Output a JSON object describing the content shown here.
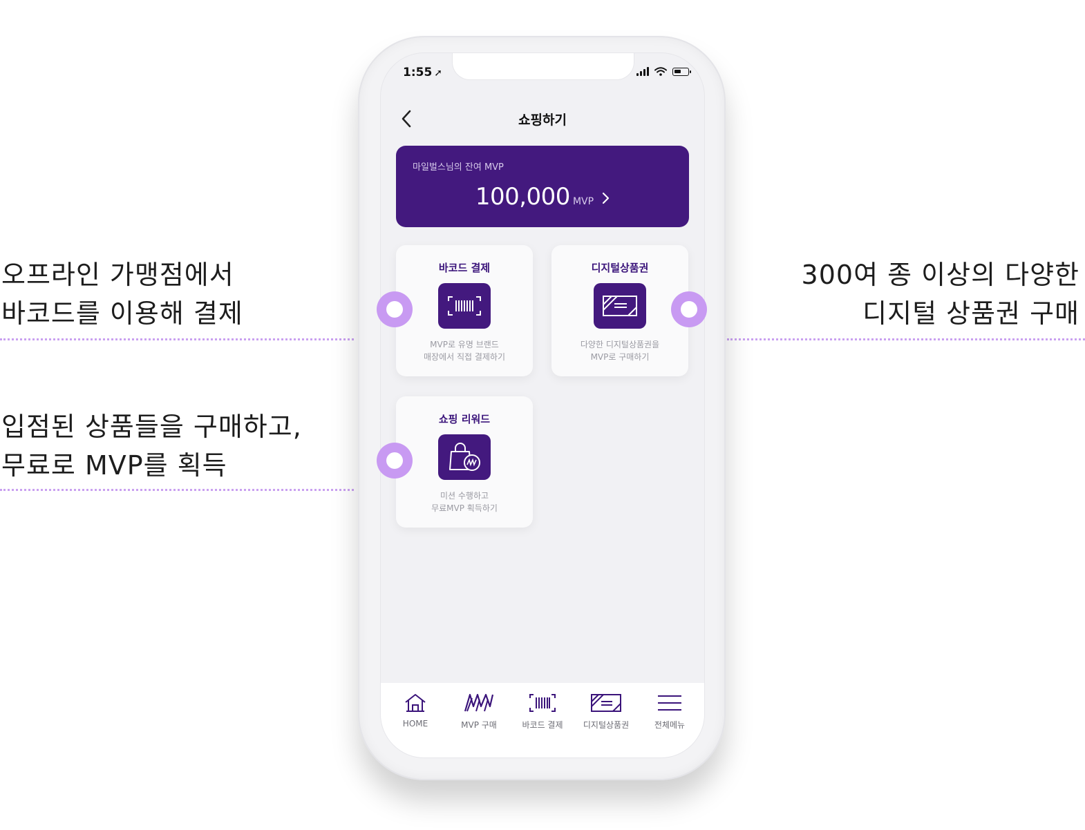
{
  "annotations": {
    "left_top": [
      "오프라인 가맹점에서",
      "바코드를 이용해 결제"
    ],
    "left_bottom": [
      "입점된 상품들을 구매하고,",
      "무료로 MVP를 획득"
    ],
    "right_top": [
      "300여 종 이상의 다양한",
      "디지털 상품권 구매"
    ]
  },
  "status_bar": {
    "time": "1:55",
    "arrow": "➚"
  },
  "nav": {
    "title": "쇼핑하기",
    "back_icon": "chevron-left-icon"
  },
  "balance": {
    "label": "마일벌스님의 잔여 MVP",
    "amount": "100,000",
    "unit": "MVP"
  },
  "cards": [
    {
      "title": "바코드 결제",
      "icon": "barcode-icon",
      "desc1": "MVP로 유명 브랜드",
      "desc2": "매장에서 직접 결제하기"
    },
    {
      "title": "디지털상품권",
      "icon": "gift-card-icon",
      "desc1": "다양한 디지털상품권을",
      "desc2": "MVP로 구매하기"
    },
    {
      "title": "쇼핑 리워드",
      "icon": "shopping-bag-icon",
      "desc1": "미션 수행하고",
      "desc2": "무료MVP 획득하기"
    }
  ],
  "tabs": [
    {
      "label": "HOME",
      "icon": "home-icon"
    },
    {
      "label": "MVP 구매",
      "icon": "mvp-logo-icon"
    },
    {
      "label": "바코드 결제",
      "icon": "barcode-icon"
    },
    {
      "label": "디지털상품권",
      "icon": "gift-card-icon"
    },
    {
      "label": "전체메뉴",
      "icon": "menu-icon"
    }
  ],
  "colors": {
    "brand_purple": "#43197e",
    "accent_pin": "#c89af2",
    "dotline": "#c9a0f0"
  }
}
